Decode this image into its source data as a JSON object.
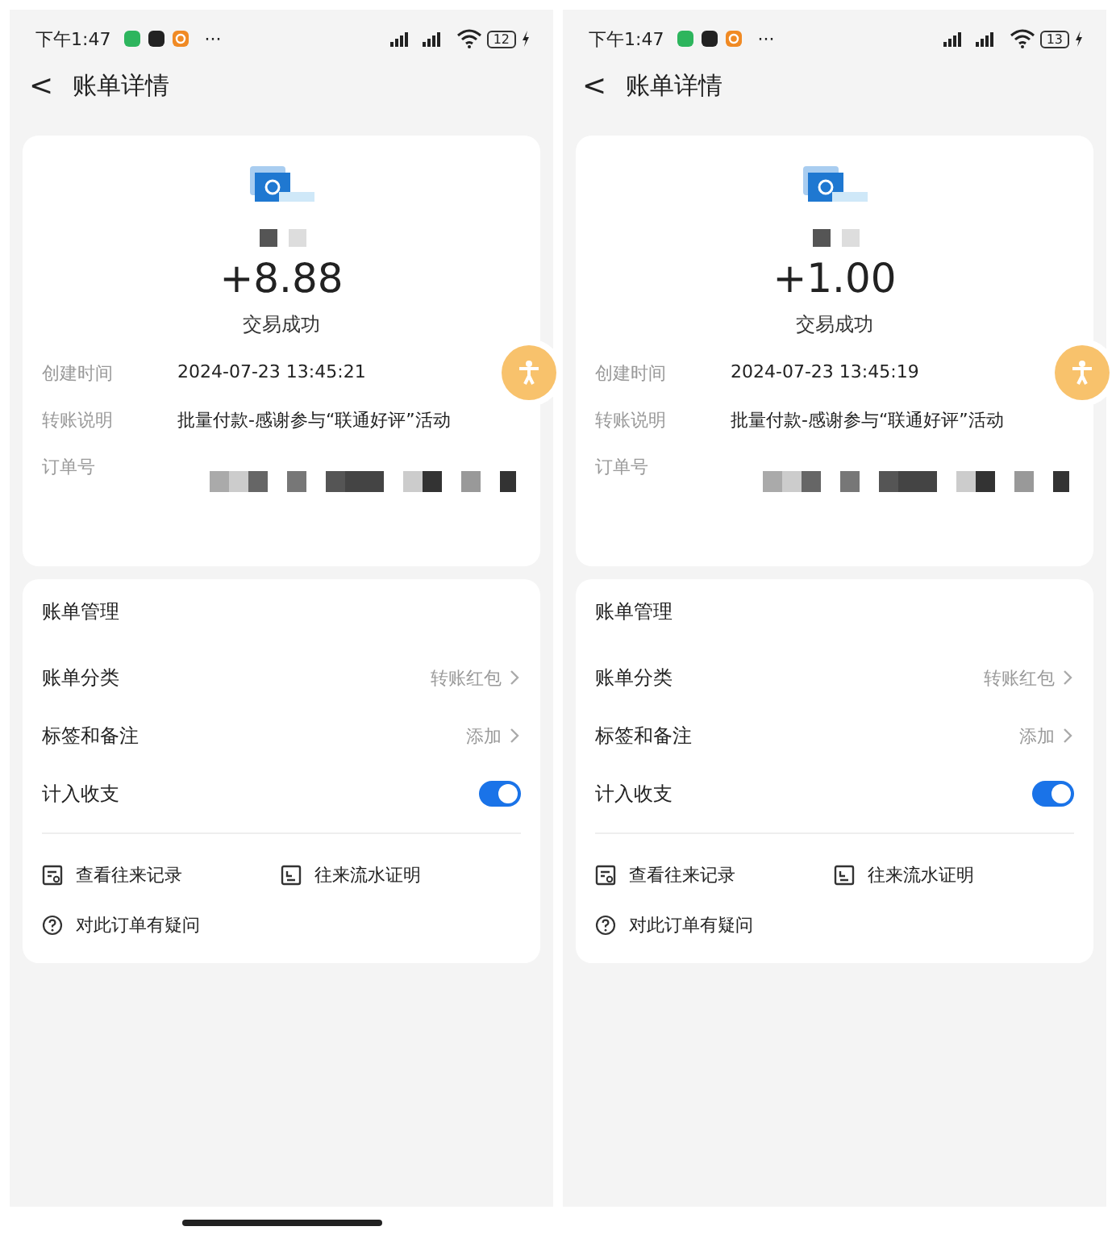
{
  "screens": [
    {
      "status_bar": {
        "time": "下午1:47",
        "more": "···",
        "battery": "12"
      },
      "nav": {
        "back": "<",
        "title": "账单详情"
      },
      "amount": "+8.88",
      "status": "交易成功",
      "details": [
        {
          "label": "创建时间",
          "value": "2024-07-23 13:45:21"
        },
        {
          "label": "转账说明",
          "value": "批量付款-感谢参与“联通好评”活动"
        }
      ],
      "order_label": "订单号",
      "manage": {
        "title": "账单管理",
        "rows": [
          {
            "kind": "link",
            "label": "账单分类",
            "value": "转账红包"
          },
          {
            "kind": "link",
            "label": "标签和备注",
            "value": "添加"
          },
          {
            "kind": "toggle",
            "label": "计入收支",
            "on": true
          }
        ],
        "links": [
          "查看往来记录",
          "往来流水证明"
        ],
        "help": "对此订单有疑问"
      },
      "home_indicator": true
    },
    {
      "status_bar": {
        "time": "下午1:47",
        "more": "···",
        "battery": "13"
      },
      "nav": {
        "back": "<",
        "title": "账单详情"
      },
      "amount": "+1.00",
      "status": "交易成功",
      "details": [
        {
          "label": "创建时间",
          "value": "2024-07-23 13:45:19"
        },
        {
          "label": "转账说明",
          "value": "批量付款-感谢参与“联通好评”活动"
        }
      ],
      "order_label": "订单号",
      "manage": {
        "title": "账单管理",
        "rows": [
          {
            "kind": "link",
            "label": "账单分类",
            "value": "转账红包"
          },
          {
            "kind": "link",
            "label": "标签和备注",
            "value": "添加"
          },
          {
            "kind": "toggle",
            "label": "计入收支",
            "on": true
          }
        ],
        "links": [
          "查看往来记录",
          "往来流水证明"
        ],
        "help": "对此订单有疑问"
      },
      "home_indicator": false
    }
  ]
}
